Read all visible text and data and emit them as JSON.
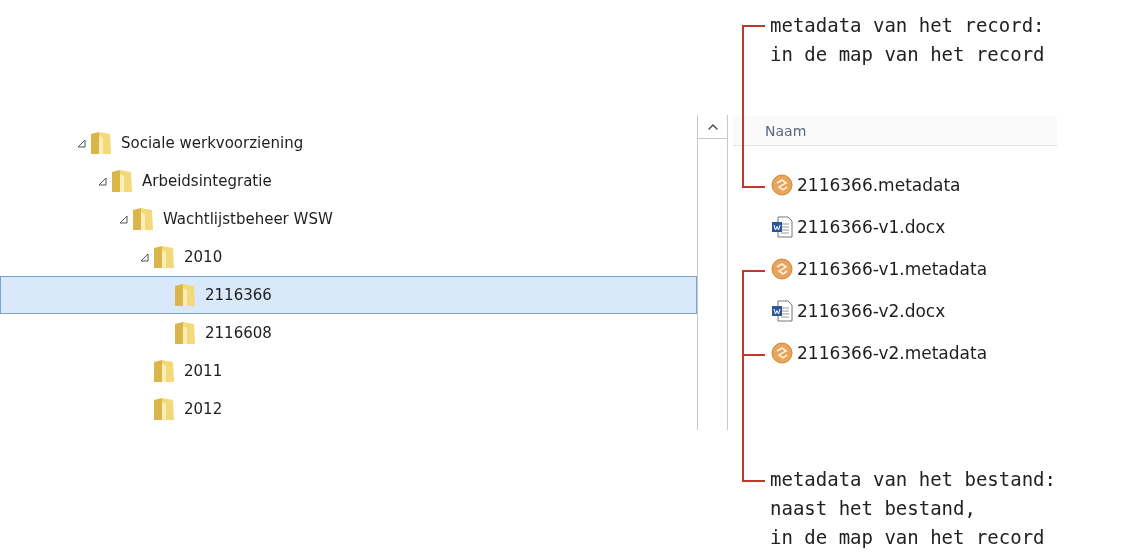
{
  "tree": [
    {
      "label": "Sociale werkvoorziening",
      "expanded": true,
      "selected": false,
      "children": [
        {
          "label": "Arbeidsintegratie",
          "expanded": true,
          "selected": false,
          "children": [
            {
              "label": "Wachtlijstbeheer WSW",
              "expanded": true,
              "selected": false,
              "children": [
                {
                  "label": "2010",
                  "expanded": true,
                  "selected": false,
                  "children": [
                    {
                      "label": "2116366",
                      "selected": true
                    },
                    {
                      "label": "2116608",
                      "selected": false
                    }
                  ]
                },
                {
                  "label": "2011",
                  "selected": false
                },
                {
                  "label": "2012",
                  "selected": false
                }
              ]
            }
          ]
        }
      ]
    }
  ],
  "file_list": {
    "column_header": "Naam",
    "files": [
      {
        "name": "2116366.metadata",
        "kind": "metadata"
      },
      {
        "name": "2116366-v1.docx",
        "kind": "word"
      },
      {
        "name": "2116366-v1.metadata",
        "kind": "metadata"
      },
      {
        "name": "2116366-v2.docx",
        "kind": "word"
      },
      {
        "name": "2116366-v2.metadata",
        "kind": "metadata"
      }
    ]
  },
  "annotations": [
    {
      "lines": [
        "metadata van het record:",
        "in de map van het record"
      ]
    },
    {
      "lines": [
        "metadata van het bestand:",
        "naast het bestand,",
        "in de map van het record"
      ]
    }
  ]
}
